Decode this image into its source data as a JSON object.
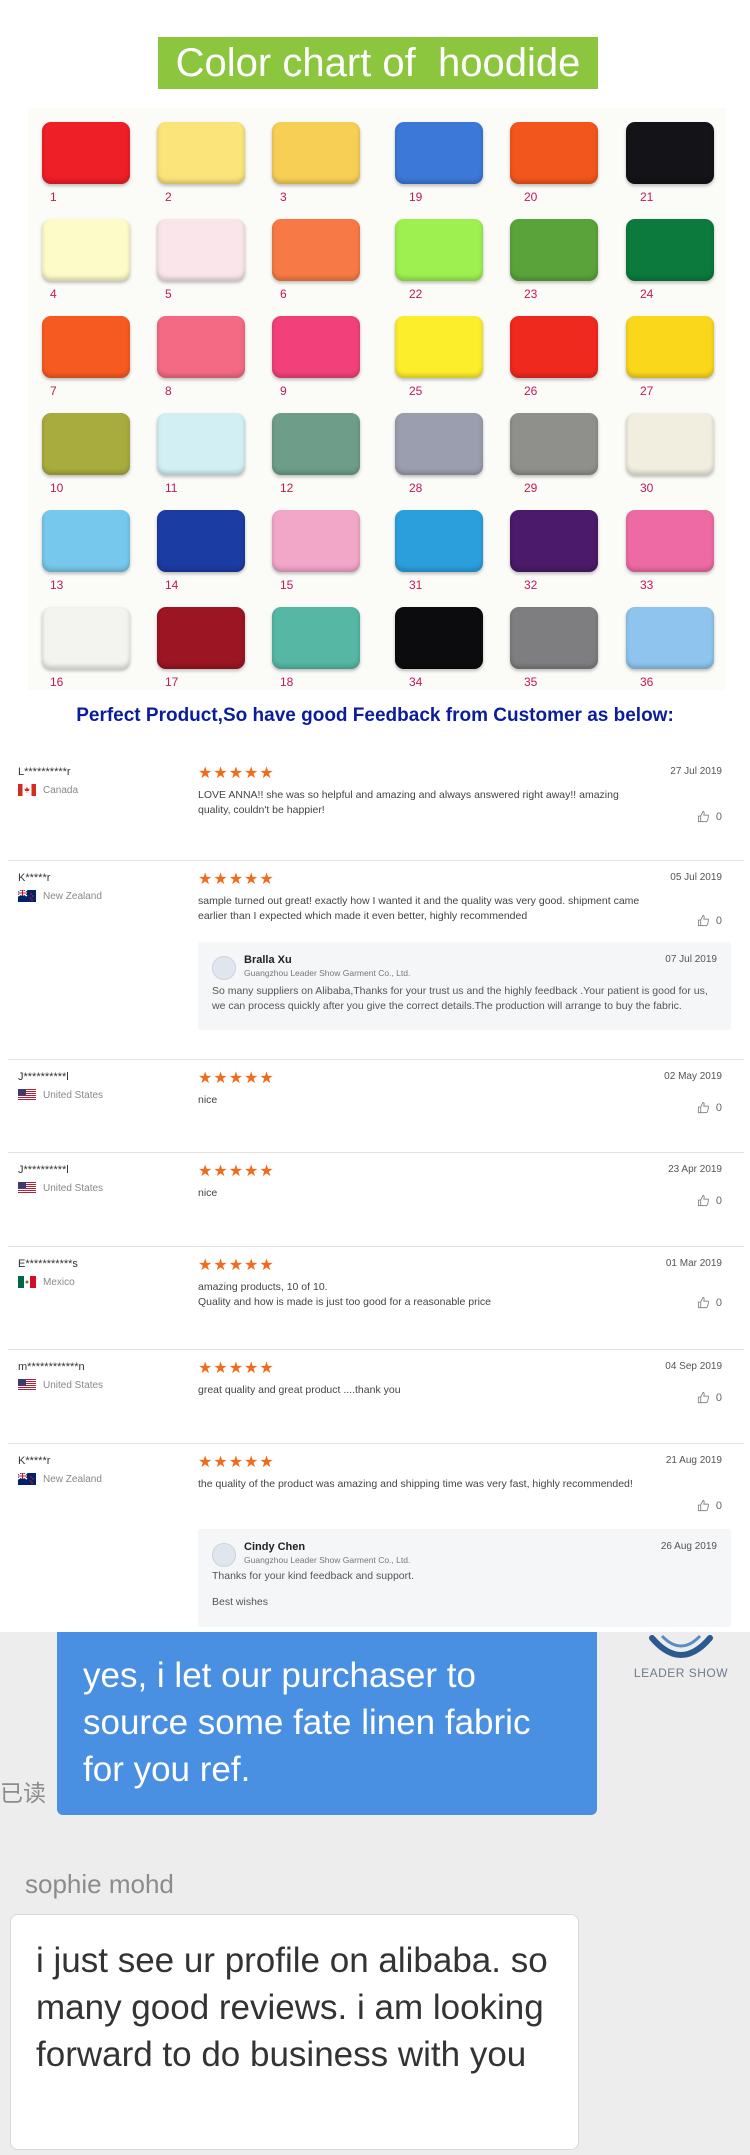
{
  "chart_title": "Color chart of  hoodide",
  "swatches": [
    {
      "num": "1",
      "color": "#ee1f26"
    },
    {
      "num": "2",
      "color": "#fbe47a"
    },
    {
      "num": "3",
      "color": "#f7cf55"
    },
    {
      "num": "19",
      "color": "#3c78d8"
    },
    {
      "num": "20",
      "color": "#f2561c"
    },
    {
      "num": "21",
      "color": "#141418"
    },
    {
      "num": "4",
      "color": "#fdfbc8"
    },
    {
      "num": "5",
      "color": "#fae6ea"
    },
    {
      "num": "6",
      "color": "#f77a46"
    },
    {
      "num": "22",
      "color": "#9ef050"
    },
    {
      "num": "23",
      "color": "#5aa33a"
    },
    {
      "num": "24",
      "color": "#0c7a3c"
    },
    {
      "num": "7",
      "color": "#f75a21"
    },
    {
      "num": "8",
      "color": "#f46a84"
    },
    {
      "num": "9",
      "color": "#f2407a"
    },
    {
      "num": "25",
      "color": "#fcee2a"
    },
    {
      "num": "26",
      "color": "#f0291f"
    },
    {
      "num": "27",
      "color": "#fbd71c"
    },
    {
      "num": "10",
      "color": "#a8ac3e"
    },
    {
      "num": "11",
      "color": "#d2f0f4"
    },
    {
      "num": "12",
      "color": "#6e9e8a"
    },
    {
      "num": "28",
      "color": "#9a9eae"
    },
    {
      "num": "29",
      "color": "#8f8f8c"
    },
    {
      "num": "30",
      "color": "#f1eee0"
    },
    {
      "num": "13",
      "color": "#76c8ec"
    },
    {
      "num": "14",
      "color": "#1b3ca3"
    },
    {
      "num": "15",
      "color": "#f2a6c8"
    },
    {
      "num": "31",
      "color": "#2a9fdc"
    },
    {
      "num": "32",
      "color": "#4b1a6a"
    },
    {
      "num": "33",
      "color": "#ee6aa4"
    },
    {
      "num": "16",
      "color": "#f3f3ef"
    },
    {
      "num": "17",
      "color": "#9b1523"
    },
    {
      "num": "18",
      "color": "#56b7a4"
    },
    {
      "num": "34",
      "color": "#0c0c0e"
    },
    {
      "num": "35",
      "color": "#7e7e80"
    },
    {
      "num": "36",
      "color": "#8ec4ee"
    }
  ],
  "feedback_heading": "Perfect Product,So have good Feedback from Customer as below:",
  "reviews": [
    {
      "name": "L**********r",
      "country": "Canada",
      "flag": "canada",
      "stars": "★★★★★",
      "date": "27 Jul 2019",
      "text": "LOVE ANNA!! she was so helpful and amazing and always answered right away!! amazing quality, couldn't be happier!",
      "likes": "0"
    },
    {
      "name": "K*****r",
      "country": "New Zealand",
      "flag": "new-zealand",
      "stars": "★★★★★",
      "date": "05 Jul 2019",
      "text": "sample turned out great! exactly how I wanted it and the quality was very good.  shipment came earlier than I expected which made it even better, highly recommended",
      "likes": "0",
      "reply": {
        "name": "Bralla Xu",
        "company": "Guangzhou Leader Show Garment Co., Ltd.",
        "date": "07 Jul 2019",
        "text": "So many suppliers on Alibaba,Thanks for your trust us and the highly feedback .Your patient is good for us, we can process quickly after you give the correct details.The production will arrange to buy the fabric."
      }
    },
    {
      "name": "J**********l",
      "country": "United States",
      "flag": "usa",
      "stars": "★★★★★",
      "date": "02 May 2019",
      "text": "nice",
      "likes": "0"
    },
    {
      "name": "J**********l",
      "country": "United States",
      "flag": "usa",
      "stars": "★★★★★",
      "date": "23 Apr 2019",
      "text": "nice",
      "likes": "0"
    },
    {
      "name": "E***********s",
      "country": "Mexico",
      "flag": "mexico",
      "stars": "★★★★★",
      "date": "01 Mar 2019",
      "text": "amazing products, 10 of 10.\nQuality and how is made is just too good for a reasonable price",
      "likes": "0"
    },
    {
      "name": "m************n",
      "country": "United States",
      "flag": "usa",
      "stars": "★★★★★",
      "date": "04 Sep 2019",
      "text": "great quality and great product ....thank you",
      "likes": "0"
    },
    {
      "name": "K*****r",
      "country": "New Zealand",
      "flag": "new-zealand",
      "stars": "★★★★★",
      "date": "21 Aug 2019",
      "text": "the quality of the product was amazing and shipping time was very fast, highly recommended!",
      "likes": "0",
      "reply": {
        "name": "Cindy Chen",
        "company": "Guangzhou Leader Show Garment Co., Ltd.",
        "date": "26 Aug 2019",
        "text": "Thanks for your kind feedback and support.",
        "text2": "Best wishes"
      }
    }
  ],
  "chat": {
    "outgoing": "yes, i let our purchaser to source some fate linen fabric for you ref.",
    "read_status": "已读",
    "logo_text": "LEADER SHOW",
    "sender": "sophie mohd",
    "incoming": "i just see ur profile on alibaba. so many good reviews. i am looking forward to do business with you"
  }
}
